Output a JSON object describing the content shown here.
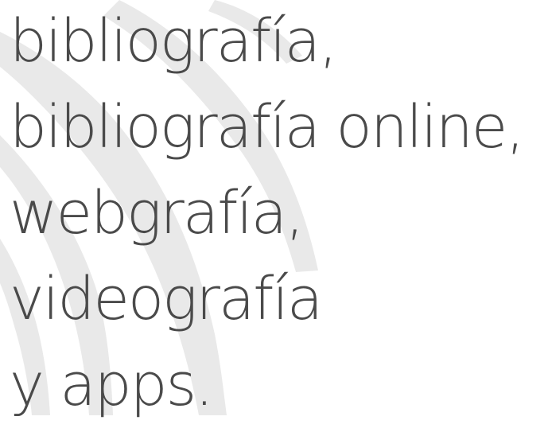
{
  "heading": {
    "lines": [
      "bibliografía,",
      "bibliografía online,",
      "webgrafía,",
      "videografía",
      "y apps."
    ]
  },
  "background": {
    "art_color": "#e9e9e9",
    "text_color": "#4a4a4a"
  }
}
